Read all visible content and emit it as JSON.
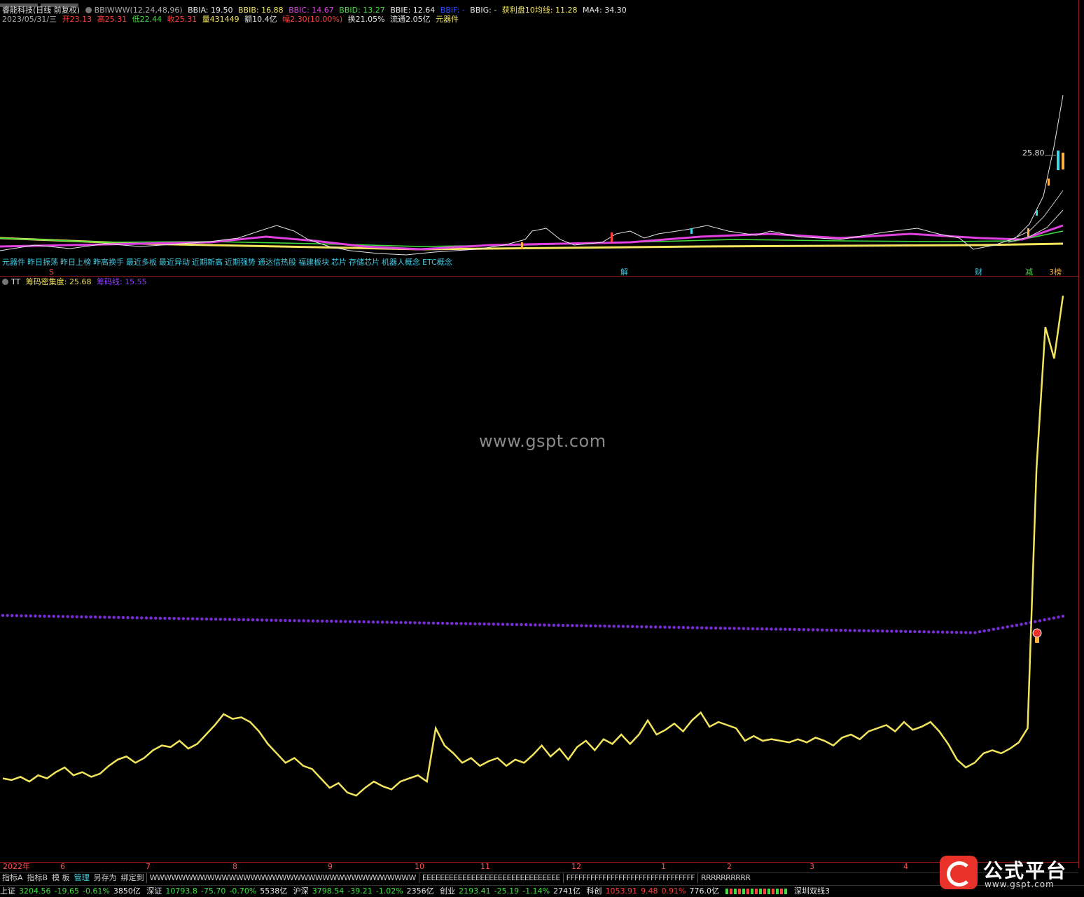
{
  "header": {
    "stock_title": "睿能科技(日线 前复权)",
    "indicator_name": "BBIWWW(12,24,48,96)",
    "bbia": "BBIA: 19.50",
    "bbib": "BBIB: 16.88",
    "bbic": "BBIC: 14.67",
    "bbid": "BBID: 13.27",
    "bbie": "BBIE: 12.64",
    "bbif": "BBIF: -",
    "bbig": "BBIG: -",
    "profit_line": "获利盘10均线: 11.28",
    "ma4": "MA4: 34.30"
  },
  "quote": {
    "date": "2023/05/31/三",
    "open": "开23.13",
    "high": "高25.31",
    "low": "低22.44",
    "close": "收25.31",
    "volume": "量431449",
    "amount": "额10.4亿",
    "change": "幅2.30(10.00%)",
    "turnover": "换21.05%",
    "float": "流通2.05亿",
    "sector": "元器件"
  },
  "price_label": "25.80",
  "concepts": [
    "元器件",
    "昨日振荡",
    "昨日上榜",
    "昨高换手",
    "最近多板",
    "最近异动",
    "近期新高",
    "近期强势",
    "通达信热股",
    "福建板块",
    "芯片",
    "存储芯片",
    "机器人概念",
    "ETC概念"
  ],
  "markers": {
    "m1": "S",
    "m2": "解",
    "m3": "财",
    "m4": "减",
    "m5": "3榜"
  },
  "sub_header": {
    "name": "TT",
    "density": "筹码密集度: 25.68",
    "chip_line": "筹码线: 15.55"
  },
  "watermark": "www.gspt.com",
  "date_axis": [
    "2022年",
    "6",
    "7",
    "8",
    "9",
    "10",
    "11",
    "12",
    "1",
    "2",
    "3",
    "4"
  ],
  "toolbar": {
    "items": [
      "指标A",
      "指标B",
      "模 板",
      "管理",
      "另存为",
      "绑定到"
    ],
    "tabs": [
      "WWWWWWWWWWWWWWWWWWWWWWWWWWWWWWWWWWWWW",
      "EEEEEEEEEEEEEEEEEEEEEEEEEEEEEEE",
      "FFFFFFFFFFFFFFFFFFFFFFFFFFFFFFFF",
      "RRRRRRRRRR"
    ]
  },
  "ticker": {
    "sh_name": "上证",
    "sh_val": "3204.56",
    "sh_chg": "-19.65",
    "sh_pct": "-0.61%",
    "sh_amt": "3850亿",
    "sz_name": "深证",
    "sz_val": "10793.8",
    "sz_chg": "-75.70",
    "sz_pct": "-0.70%",
    "sz_amt": "5538亿",
    "hs_name": "沪深",
    "hs_val": "3798.54",
    "hs_chg": "-39.21",
    "hs_pct": "-1.02%",
    "hs_amt": "2356亿",
    "cy_name": "创业",
    "cy_val": "2193.41",
    "cy_chg": "-25.19",
    "cy_pct": "-1.14%",
    "cy_amt": "2741亿",
    "kc_name": "科创",
    "kc_val": "1053.91",
    "kc_chg": "9.48",
    "kc_pct": "0.91%",
    "kc_amt": "776.0亿",
    "scheme": "深圳双线3"
  },
  "logo": {
    "text": "公式平台",
    "url": "www.gspt.com"
  },
  "colors": {
    "yellow_line": "#f2e45c",
    "purple_dots": "#7a2cd8",
    "magenta": "#e040e0",
    "axis_red": "#8a1a1a"
  },
  "chart_data": {
    "type": "line",
    "series": [
      {
        "name": "筹码密集度",
        "values": [
          5.2,
          5.1,
          5.3,
          5.0,
          5.4,
          5.2,
          5.6,
          5.9,
          5.4,
          5.6,
          5.3,
          5.5,
          6.0,
          6.4,
          6.6,
          6.2,
          6.5,
          7.0,
          7.3,
          7.2,
          7.6,
          7.1,
          7.4,
          8.0,
          8.6,
          9.3,
          9.0,
          9.1,
          8.8,
          8.2,
          7.4,
          6.8,
          6.2,
          6.5,
          6.0,
          5.8,
          5.2,
          4.6,
          4.9,
          4.3,
          4.1,
          4.6,
          5.0,
          4.7,
          4.5,
          5.0,
          5.2,
          5.4,
          5.0,
          8.4,
          7.3,
          6.8,
          6.2,
          6.5,
          6.0,
          6.3,
          6.5,
          6.0,
          6.4,
          6.2,
          6.7,
          7.3,
          6.6,
          7.1,
          6.4,
          7.2,
          7.6,
          7.0,
          7.7,
          7.4,
          8.0,
          7.4,
          8.0,
          8.9,
          8.0,
          8.3,
          8.7,
          8.2,
          8.9,
          9.4,
          8.5,
          8.8,
          8.6,
          8.4,
          7.6,
          7.9,
          7.6,
          7.7,
          7.6,
          7.5,
          7.7,
          7.5,
          7.8,
          7.6,
          7.3,
          7.8,
          8.0,
          7.7,
          8.2,
          8.4,
          8.6,
          8.2,
          8.8,
          8.3,
          8.5,
          8.8,
          8.2,
          7.4,
          6.4,
          5.9,
          6.2,
          6.8,
          7.0,
          6.8,
          7.1,
          7.5,
          8.4,
          25.0,
          34.0,
          32.0,
          36.0
        ]
      },
      {
        "name": "筹码线",
        "values": [
          15.6,
          15.55,
          15.5,
          15.45,
          15.4,
          15.35,
          15.3,
          15.25,
          15.2,
          15.15,
          15.1,
          15.05,
          15.0,
          14.95,
          14.9,
          14.85,
          14.8,
          14.75,
          14.7,
          14.65,
          14.6,
          14.55,
          14.5,
          15.0,
          15.55
        ]
      }
    ],
    "x_range_labels": [
      "2022年",
      "6",
      "7",
      "8",
      "9",
      "10",
      "11",
      "12",
      "1",
      "2",
      "3",
      "4"
    ]
  }
}
